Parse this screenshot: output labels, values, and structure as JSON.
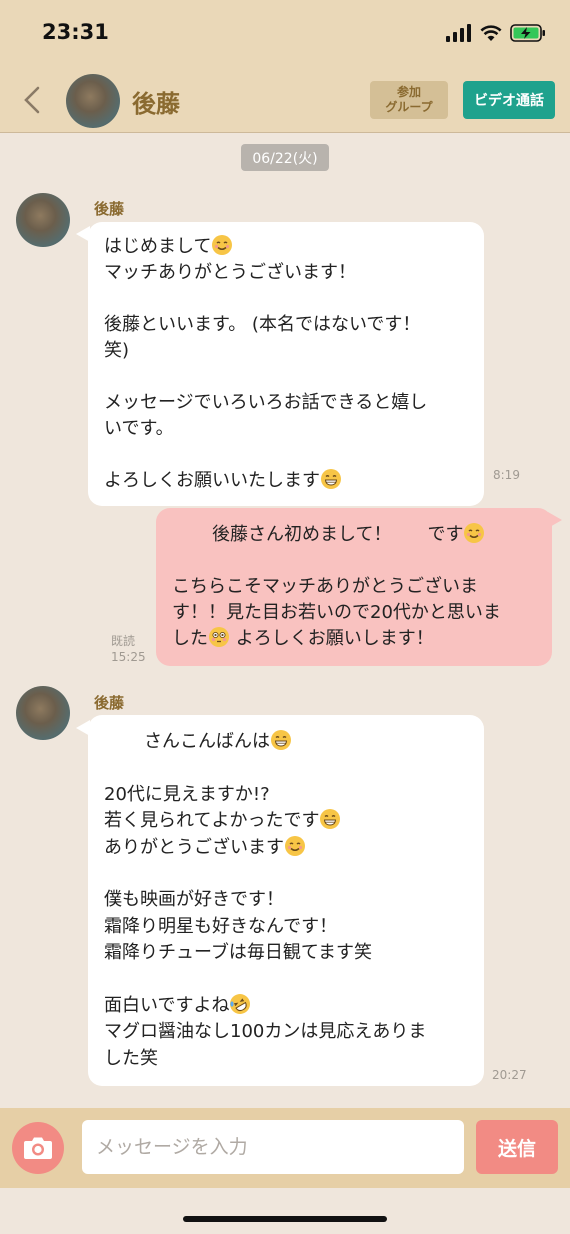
{
  "status": {
    "time": "23:31"
  },
  "header": {
    "contact_name": "後藤",
    "group_button": "参加\nグループ",
    "video_button": "ビデオ通話"
  },
  "date_label": "06/22(火)",
  "messages": [
    {
      "sender": "後藤",
      "parts": [
        "はじめまして",
        "\nマッチありがとうございます！\n\n後藤といいます。 (本名ではないです！\n笑)\n\nメッセージでいろいろお話できると嬉し\nいです。\n\nよろしくお願いいたします"
      ],
      "time": "8:19"
    },
    {
      "parts": [
        "後藤さん初めまして！　　です",
        "\n\nこちらこそマッチありがとうございま\nす！！見た目お若いので20代かと思いま\nした",
        " よろしくお願いします！"
      ],
      "read_label": "既読",
      "time": "15:25"
    },
    {
      "sender": "後藤",
      "parts": [
        "さんこんばんは",
        "\n\n20代に見えますか!?\n若く見られてよかったです",
        "\nありがとうございます",
        "\n\n僕も映画が好きです！\n霜降り明星も好きなんです！\n霜降りチューブは毎日観てます笑\n\n面白いですよね",
        "\nマグロ醤油なし100カンは見応えありま\nした笑"
      ],
      "time": "20:27"
    }
  ],
  "input": {
    "placeholder": "メッセージを入力",
    "value": ""
  },
  "send_button": "送信",
  "colors": {
    "header_bg": "#ead8b8",
    "chat_bg": "#efe6dc",
    "accent_green": "#1fa28d",
    "outgoing_bubble": "#f9c2c0",
    "send_button": "#f28b84",
    "name_brown": "#8a6a30"
  },
  "icons": [
    "back-chevron-icon",
    "signal-icon",
    "wifi-icon",
    "battery-charging-icon",
    "camera-icon",
    "smile-emoji-icon",
    "grin-emoji-icon",
    "flushed-emoji-icon",
    "rofl-emoji-icon"
  ]
}
